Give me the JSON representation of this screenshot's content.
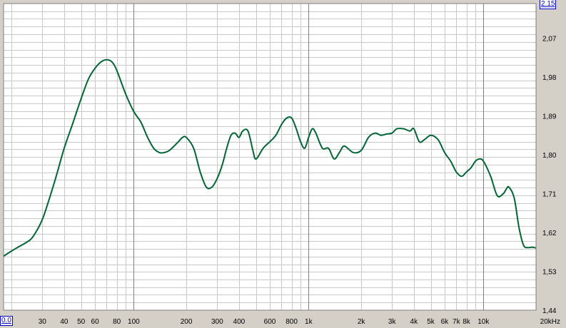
{
  "chart_data": {
    "type": "line",
    "title": "",
    "xlabel": "",
    "ylabel": "",
    "x_scale": "log",
    "xlim": [
      18,
      20000
    ],
    "ylim": [
      1.44,
      2.15
    ],
    "grid": true,
    "x_ticks": [
      {
        "value": 30,
        "label": "30"
      },
      {
        "value": 40,
        "label": "40"
      },
      {
        "value": 50,
        "label": "50"
      },
      {
        "value": 60,
        "label": "60"
      },
      {
        "value": 80,
        "label": "80"
      },
      {
        "value": 100,
        "label": "100"
      },
      {
        "value": 200,
        "label": "200"
      },
      {
        "value": 300,
        "label": "300"
      },
      {
        "value": 400,
        "label": "400"
      },
      {
        "value": 600,
        "label": "600"
      },
      {
        "value": 800,
        "label": "800"
      },
      {
        "value": 1000,
        "label": "1k"
      },
      {
        "value": 2000,
        "label": "2k"
      },
      {
        "value": 3000,
        "label": "3k"
      },
      {
        "value": 4000,
        "label": "4k"
      },
      {
        "value": 5000,
        "label": "5k"
      },
      {
        "value": 6000,
        "label": "6k"
      },
      {
        "value": 7000,
        "label": "7k"
      },
      {
        "value": 8000,
        "label": "8k"
      },
      {
        "value": 10000,
        "label": "10k"
      },
      {
        "value": 20000,
        "label": "20kHz"
      }
    ],
    "y_ticks": [
      {
        "value": 1.53,
        "label": "1,53"
      },
      {
        "value": 1.62,
        "label": "1,62"
      },
      {
        "value": 1.71,
        "label": "1,71"
      },
      {
        "value": 1.8,
        "label": "1,80"
      },
      {
        "value": 1.89,
        "label": "1,89"
      },
      {
        "value": 1.98,
        "label": "1,98"
      },
      {
        "value": 2.07,
        "label": "2,07"
      }
    ],
    "series": [
      {
        "color": "#006633",
        "x": [
          18,
          20,
          22,
          25,
          27,
          30,
          33,
          36,
          40,
          45,
          50,
          55,
          60,
          65,
          70,
          75,
          80,
          90,
          100,
          110,
          120,
          130,
          140,
          150,
          160,
          170,
          180,
          190,
          200,
          220,
          240,
          260,
          280,
          300,
          320,
          340,
          360,
          380,
          400,
          420,
          450,
          480,
          500,
          550,
          600,
          650,
          700,
          750,
          800,
          850,
          900,
          950,
          1000,
          1050,
          1100,
          1200,
          1300,
          1400,
          1500,
          1600,
          1800,
          2000,
          2200,
          2400,
          2600,
          2800,
          3000,
          3200,
          3500,
          3800,
          4000,
          4300,
          4600,
          5000,
          5500,
          6000,
          6500,
          7000,
          7500,
          8000,
          8500,
          9000,
          9500,
          10000,
          11000,
          12000,
          13000,
          13500,
          14000,
          15000,
          16000,
          17000,
          18000,
          19000,
          20000
        ],
        "y": [
          1.565,
          1.577,
          1.587,
          1.6,
          1.615,
          1.65,
          1.7,
          1.75,
          1.815,
          1.875,
          1.93,
          1.975,
          2.0,
          2.015,
          2.02,
          2.015,
          1.995,
          1.94,
          1.9,
          1.875,
          1.84,
          1.815,
          1.805,
          1.805,
          1.81,
          1.82,
          1.83,
          1.84,
          1.84,
          1.815,
          1.76,
          1.725,
          1.725,
          1.745,
          1.775,
          1.815,
          1.845,
          1.85,
          1.84,
          1.855,
          1.855,
          1.81,
          1.79,
          1.815,
          1.83,
          1.845,
          1.87,
          1.885,
          1.885,
          1.86,
          1.83,
          1.815,
          1.84,
          1.86,
          1.85,
          1.815,
          1.815,
          1.79,
          1.805,
          1.82,
          1.805,
          1.81,
          1.84,
          1.85,
          1.845,
          1.848,
          1.85,
          1.86,
          1.86,
          1.855,
          1.86,
          1.83,
          1.835,
          1.845,
          1.835,
          1.805,
          1.785,
          1.76,
          1.75,
          1.76,
          1.77,
          1.785,
          1.79,
          1.785,
          1.75,
          1.705,
          1.71,
          1.72,
          1.725,
          1.7,
          1.63,
          1.59,
          1.585,
          1.586,
          1.584
        ]
      }
    ]
  },
  "ymax_field": "2.15",
  "ymin_field": "0.0"
}
